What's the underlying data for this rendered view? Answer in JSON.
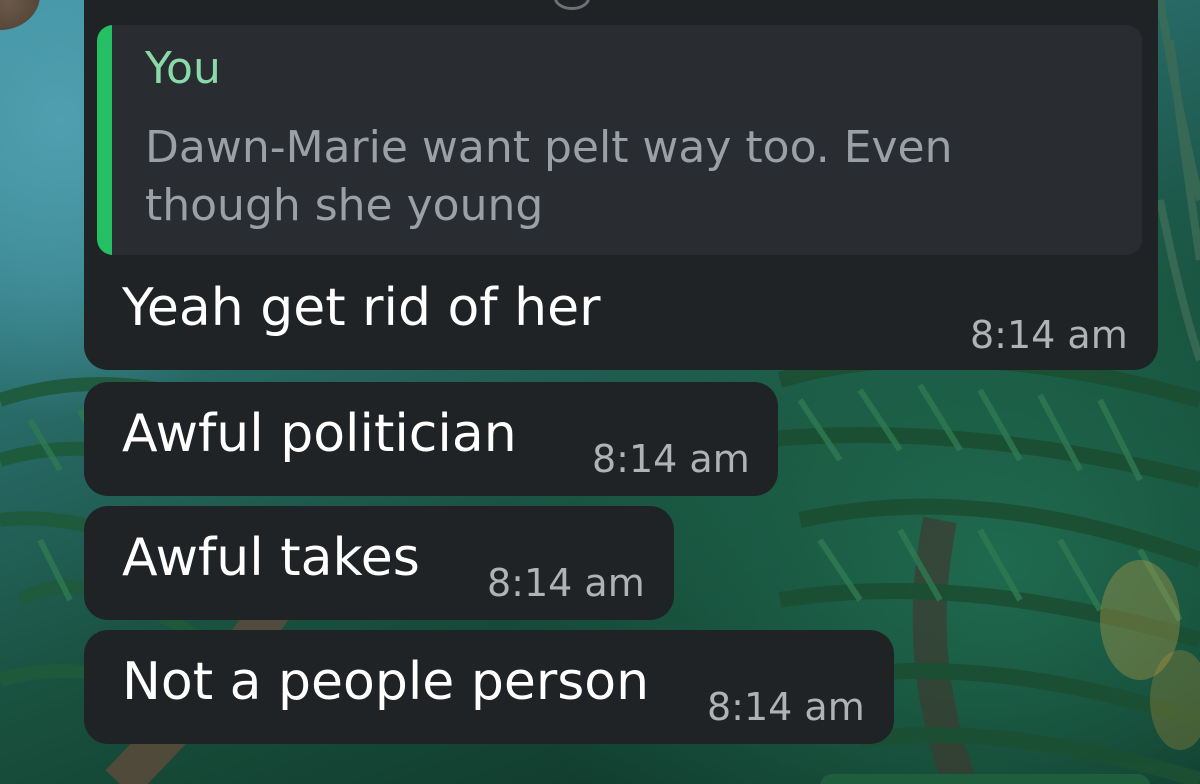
{
  "reply": {
    "author": "You",
    "quoted_text": "Dawn-Marie want pelt way too. Even though she young"
  },
  "messages": [
    {
      "text": "Yeah get rid of her",
      "time": "8:14 am"
    },
    {
      "text": "Awful politician",
      "time": "8:14 am"
    },
    {
      "text": "Awful takes",
      "time": "8:14 am"
    },
    {
      "text": "Not a people person",
      "time": "8:14 am"
    }
  ],
  "colors": {
    "bubble": "#202326",
    "reply_box": "#292d31",
    "reply_bar": "#25c063",
    "reply_author": "#8ad9a8",
    "timestamp": "#b0b3b6"
  }
}
